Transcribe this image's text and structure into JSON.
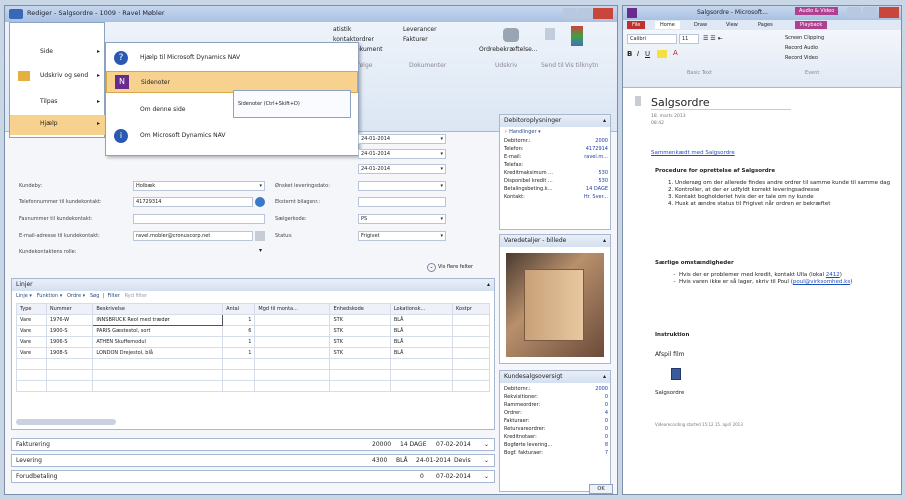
{
  "nav": {
    "title": "Rediger - Salgsordre - 1009 · Ravel Møbler",
    "file_menu": [
      {
        "label": "Side",
        "arrow": "▸"
      },
      {
        "label": "Udskriv og send",
        "arrow": "▸"
      },
      {
        "label": "Tilpas",
        "arrow": "▸"
      },
      {
        "label": "Hjælp",
        "arrow": "▸"
      }
    ],
    "help_submenu": [
      "Hjælp til Microsoft Dynamics NAV",
      "Sidenoter",
      "Om denne side",
      "Om Microsoft Dynamics NAV"
    ],
    "tooltip": "Sidenoter (Ctrl+Skift+D)",
    "ribbon": {
      "statistik": "atistik",
      "kontaktordrer": "kontaktordrer",
      "arkiver": "rkiver dokument",
      "grp1": "Rækkefølge",
      "leverancer": "Leverancer",
      "fakturaer": "Fakturer",
      "grp2": "Dokumenter",
      "ordre_bekraeft": "Ordrebekræftelse...",
      "grp3": "Udskriv",
      "send_til": "Send til",
      "vis_tilknyt": "Vis tilknytn"
    },
    "dates": [
      "24-01-2014",
      "24-01-2014",
      "24-01-2014"
    ],
    "form": {
      "kundeby_lbl": "Kundeby:",
      "kundeby_val": "Holbæk",
      "telefon_lbl": "Telefonnummer til kundekontakt:",
      "telefon_val": "41729314",
      "fax_lbl": "Faxnummer til kundekontakt:",
      "email_lbl": "E-mail-adresse til kundekontakt:",
      "email_val": "ravel.mobler@cronuscorp.net",
      "rolle_lbl": "Kundekontaktens rolle:",
      "lev_dato_lbl": "Ønsket leveringsdato:",
      "ekstern_lbl": "Eksternt bilagsnr.:",
      "saelger_lbl": "Sælgerkode:",
      "saelger_val": "PS",
      "status_lbl": "Status:",
      "status_val": "Frigivet",
      "vis_flere": "Vis flere felter"
    },
    "lines": {
      "header": "Linjer",
      "toolbar": [
        "Linje",
        "Funktion",
        "Ordre",
        "Søg",
        "Filter",
        "Ryd filter"
      ],
      "columns": [
        "Type",
        "Nummer",
        "Beskrivelse",
        "Antal",
        "Mgd til monta...",
        "Enhedskode",
        "Lokationsk...",
        "Kostpr"
      ],
      "rows": [
        [
          "Vare",
          "1976-W",
          "INNSBRUCK Reol med trædør",
          "1",
          "",
          "STK",
          "BLÅ",
          ""
        ],
        [
          "Vare",
          "1900-S",
          "PARIS Gæstestol, sort",
          "6",
          "",
          "STK",
          "BLÅ",
          ""
        ],
        [
          "Vare",
          "1906-S",
          "ATHEN Skuffemodul",
          "1",
          "",
          "STK",
          "BLÅ",
          ""
        ],
        [
          "Vare",
          "1908-S",
          "LONDON Drejestol, blå",
          "1",
          "",
          "STK",
          "BLÅ",
          ""
        ]
      ]
    },
    "fasttabs": [
      {
        "label": "Fakturering",
        "v1": "20000",
        "v2": "14 DAGE",
        "v3": "07-02-2014"
      },
      {
        "label": "Levering",
        "v1": "4300",
        "v2": "BLÅ",
        "v3": "24-01-2014",
        "v4": "Devis"
      },
      {
        "label": "Forudbetaling",
        "v1": "0",
        "v2": "",
        "v3": "07-02-2014"
      }
    ],
    "debitor": {
      "header": "Debitoroplysninger",
      "handlinger": "Handlinger",
      "rows": [
        [
          "Debitornr.:",
          "2000"
        ],
        [
          "Telefon:",
          "4172914"
        ],
        [
          "E-mail:",
          "ravel.m..."
        ],
        [
          "Telefax:",
          ""
        ],
        [
          "Kreditmaksimum ...",
          "530"
        ],
        [
          "Disponibel kredit ...",
          "530"
        ],
        [
          "Betalingsbeting.k...",
          "14 DAGE"
        ],
        [
          "Kontakt:",
          "Hr. Sver..."
        ]
      ]
    },
    "varedetaljer": "Varedetaljer - billede",
    "kundesalg": {
      "header": "Kundesalgsoversigt",
      "rows": [
        [
          "Debitornr.:",
          "2000"
        ],
        [
          "Rekvisitioner:",
          "0"
        ],
        [
          "Rammeordrer:",
          "0"
        ],
        [
          "Ordrer:",
          "4"
        ],
        [
          "Fakturaer:",
          "0"
        ],
        [
          "Returvareordrer:",
          "0"
        ],
        [
          "Kreditnotaer:",
          "0"
        ],
        [
          "Bogførte levering...",
          "8"
        ],
        [
          "Bogf. fakturaer:",
          "7"
        ]
      ]
    },
    "ok": "OK"
  },
  "onenote": {
    "title": "Salgsordre - Microsoft...",
    "contextual": "Audio & Video",
    "tabs": [
      "File",
      "Home",
      "Draw",
      "View",
      "Pages",
      "Playback"
    ],
    "font_name": "Calibri",
    "font_size": "11",
    "group_basic": "Basic Text",
    "group_record": "Event",
    "rec_buttons": [
      "Screen Clipping",
      "Record Audio",
      "Record Video"
    ],
    "page_title": "Salgsordre",
    "page_date": "18. marts 2013",
    "page_time": "08:42",
    "link_linked": "Sammenkædt med Salgsordre",
    "proc_heading": "Procedure for oprettelse af Salgsordre",
    "steps": [
      "Undersøg om der allerede findes andre ordrer til samme kunde til samme dag",
      "Kontroller, at der er udfyldt korrekt leveringsadresse",
      "Kontakt bogholderiet hvis der er tale om ny kunde",
      "Husk at ændre status til Frigivet når ordren er bekræftet"
    ],
    "special_heading": "Særlige omstændigheder",
    "special": [
      {
        "text": "Hvis der er problemer med kredit, kontakt Ulla (lokal ",
        "link": "2412",
        "after": ")"
      },
      {
        "text": "Hvis varen ikke er så lager, skriv til Poul (",
        "link": "poul@virksomhed.ks",
        "after": ")"
      }
    ],
    "instruktion": "Instruktion",
    "afspil": "Afspil film",
    "attach_name": "Salgsordre",
    "recording": "Videorecording started 15:12 15. april 2013"
  }
}
